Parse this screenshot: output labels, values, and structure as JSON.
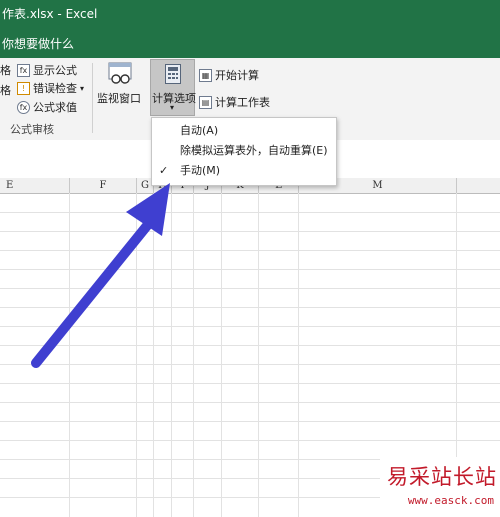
{
  "titlebar": {
    "text": "作表.xlsx  -  Excel"
  },
  "tellme": {
    "text": "你想要做什么"
  },
  "ribbon": {
    "left_char_1": "格",
    "left_char_2": "格",
    "show_formulas": "显示公式",
    "error_checking": "错误检查",
    "evaluate_formula": "公式求值",
    "watch_window": "监视窗口",
    "calc_options": "计算选项",
    "calc_now": "开始计算",
    "calc_sheet": "计算工作表",
    "group_label": "公式审核"
  },
  "calc_menu": {
    "items": [
      {
        "label": "自动(A)",
        "checked": false
      },
      {
        "label": "除模拟运算表外，自动重算(E)",
        "checked": false
      },
      {
        "label": "手动(M)",
        "checked": true
      }
    ],
    "check_glyph": "✓"
  },
  "columns": [
    "E",
    "F",
    "G",
    "H",
    "I",
    "J",
    "K",
    "L",
    "M"
  ],
  "annotation": {
    "arrow_color": "#3f3fd0"
  },
  "watermark": {
    "text": "易采站长站",
    "url": "www.easck.com"
  }
}
